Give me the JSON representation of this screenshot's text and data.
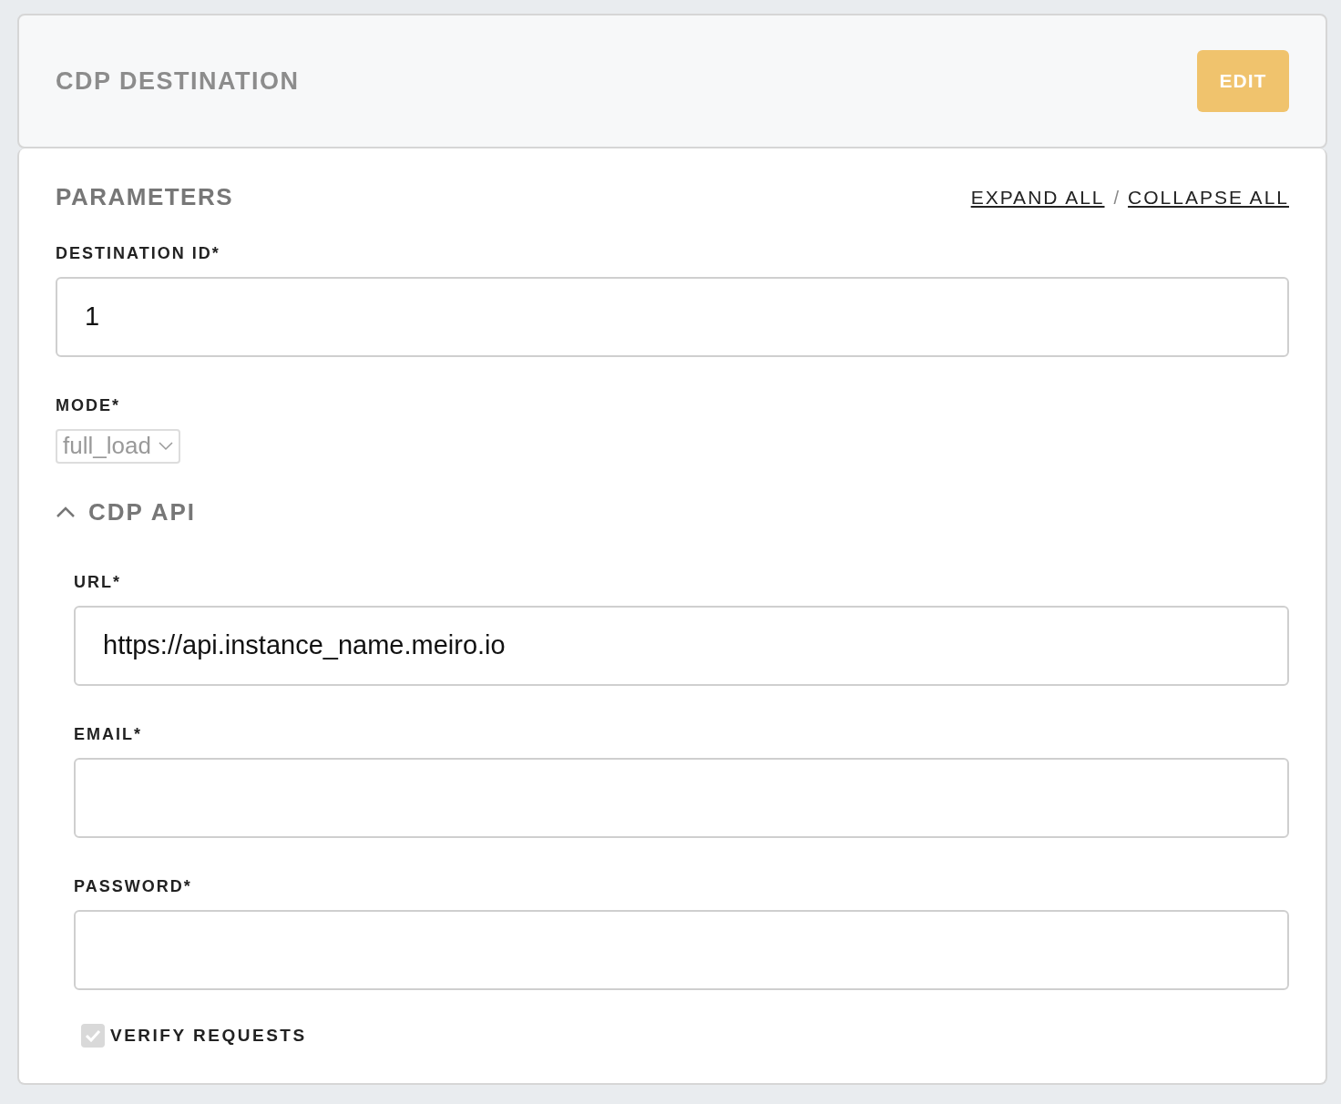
{
  "header": {
    "title": "CDP DESTINATION",
    "edit_button": {
      "label": "EDIT",
      "disabled": true
    }
  },
  "parameters": {
    "title": "PARAMETERS",
    "expand_all": "EXPAND ALL",
    "separator": "/",
    "collapse_all": "COLLAPSE ALL",
    "fields": [
      {
        "kind": "text",
        "label": "DESTINATION ID*",
        "value": "1"
      },
      {
        "kind": "select",
        "label": "MODE*",
        "value": "full_load",
        "disabled": true
      }
    ],
    "sections": [
      {
        "title": "CDP API",
        "expanded": true,
        "fields": [
          {
            "kind": "text",
            "label": "URL*",
            "value": "https://api.instance_name.meiro.io"
          },
          {
            "kind": "text",
            "label": "EMAIL*"
          },
          {
            "kind": "password",
            "label": "PASSWORD*"
          },
          {
            "kind": "checkbox",
            "label": "VERIFY REQUESTS",
            "checked": true,
            "disabled": true
          }
        ]
      }
    ]
  }
}
